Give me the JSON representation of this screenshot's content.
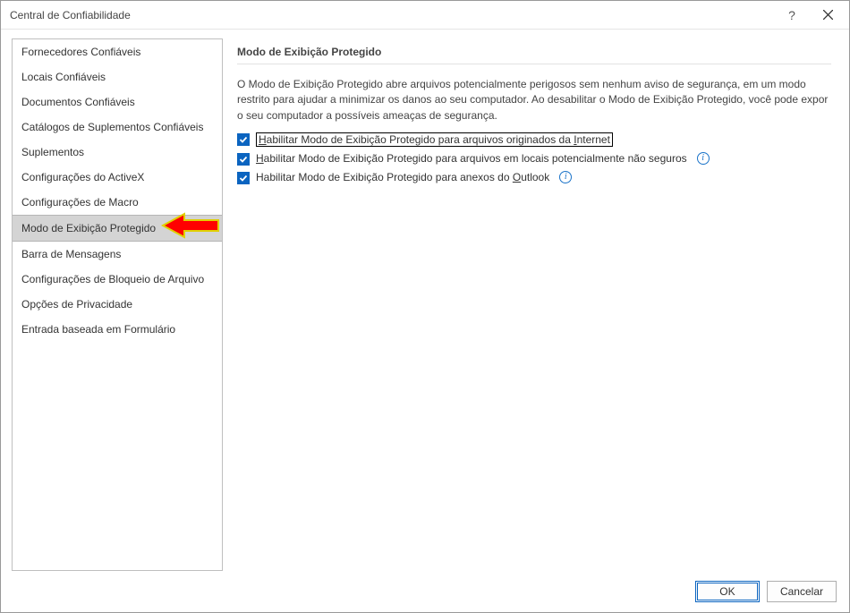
{
  "window": {
    "title": "Central de Confiabilidade"
  },
  "sidebar": {
    "items": [
      {
        "label": "Fornecedores Confiáveis"
      },
      {
        "label": "Locais Confiáveis"
      },
      {
        "label": "Documentos Confiáveis"
      },
      {
        "label": "Catálogos de Suplementos Confiáveis"
      },
      {
        "label": "Suplementos"
      },
      {
        "label": "Configurações do ActiveX"
      },
      {
        "label": "Configurações de Macro"
      },
      {
        "label": "Modo de Exibição Protegido"
      },
      {
        "label": "Barra de Mensagens"
      },
      {
        "label": "Configurações de Bloqueio de Arquivo"
      },
      {
        "label": "Opções de Privacidade"
      },
      {
        "label": "Entrada baseada em Formulário"
      }
    ],
    "selected_index": 7
  },
  "content": {
    "section_title": "Modo de Exibição Protegido",
    "description": "O Modo de Exibição Protegido abre arquivos potencialmente perigosos sem nenhum aviso de segurança, em um modo restrito para ajudar a minimizar os danos ao seu computador. Ao desabilitar o Modo de Exibição Protegido, você pode expor o seu computador a possíveis ameaças de segurança.",
    "checks": [
      {
        "pre": "",
        "hot": "H",
        "post": "abilitar Modo de Exibição Protegido para arquivos originados da ",
        "hot2": "I",
        "post2": "nternet",
        "checked": true,
        "focused": true,
        "info": false
      },
      {
        "pre": "",
        "hot": "H",
        "post": "abilitar Modo de Exibição Protegido para arquivos em locais potencialmente não seguros",
        "hot2": "",
        "post2": "",
        "checked": true,
        "focused": false,
        "info": true
      },
      {
        "pre": "Habilitar Modo de Exibição Protegido para anexos do ",
        "hot": "O",
        "post": "utlook",
        "hot2": "",
        "post2": "",
        "checked": true,
        "focused": false,
        "info": true
      }
    ]
  },
  "footer": {
    "ok": "OK",
    "cancel": "Cancelar"
  }
}
